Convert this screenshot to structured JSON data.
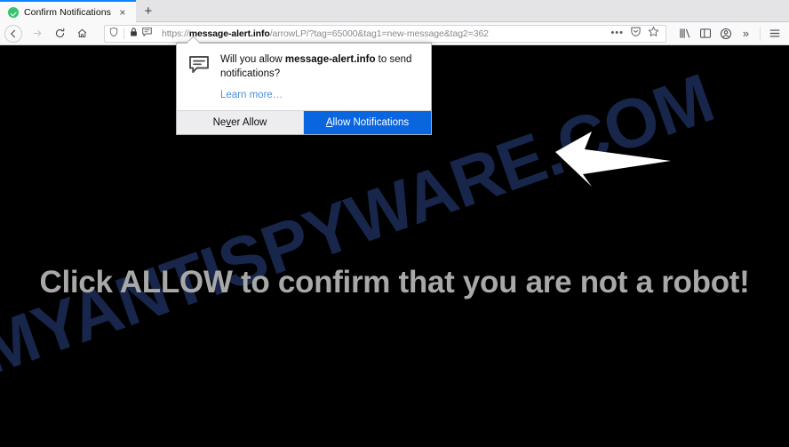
{
  "browser": {
    "tab": {
      "title": "Confirm Notifications",
      "favicon": "green-check-circle-icon",
      "close_label": "×"
    },
    "newtab_label": "+",
    "nav": {
      "back": "back-arrow-icon",
      "forward": "forward-arrow-icon",
      "reload": "reload-icon",
      "home": "home-icon"
    },
    "urlbar": {
      "shield_icon": "shield-icon",
      "lock_icon": "padlock-icon",
      "notification_icon": "notification-bubble-icon",
      "url_scheme": "https://",
      "url_host": "message-alert.info",
      "url_path": "/arrowLP/?tag=65000&tag1=new-message&tag2=362",
      "page_actions_label": "•••",
      "pocket_icon": "pocket-save-icon",
      "bookmark_icon": "bookmark-star-icon"
    },
    "toolbar_right": {
      "library_icon": "library-icon",
      "sidebar_icon": "sidebar-icon",
      "account_icon": "account-avatar-icon",
      "overflow_label": "»",
      "menu_icon": "hamburger-menu-icon"
    }
  },
  "permission_popup": {
    "icon": "notification-bubble-icon",
    "question_prefix": "Will you allow ",
    "question_host": "message-alert.info",
    "question_suffix": " to send notifications?",
    "learn_more": "Learn more…",
    "deny_button": {
      "accesskey_before": "Ne",
      "accesskey": "v",
      "accesskey_after": "er Allow"
    },
    "allow_button": {
      "accesskey": "A",
      "accesskey_after": "llow Notifications"
    }
  },
  "page": {
    "headline": "Click ALLOW to confirm that you are not a robot!",
    "watermark": "MYANTISPYWARE.COM",
    "arrow": "left-pointing-arrow",
    "background_color": "#000000",
    "headline_color": "#a8a8a8",
    "watermark_color": "#17264a",
    "accent_color": "#0a66df"
  }
}
